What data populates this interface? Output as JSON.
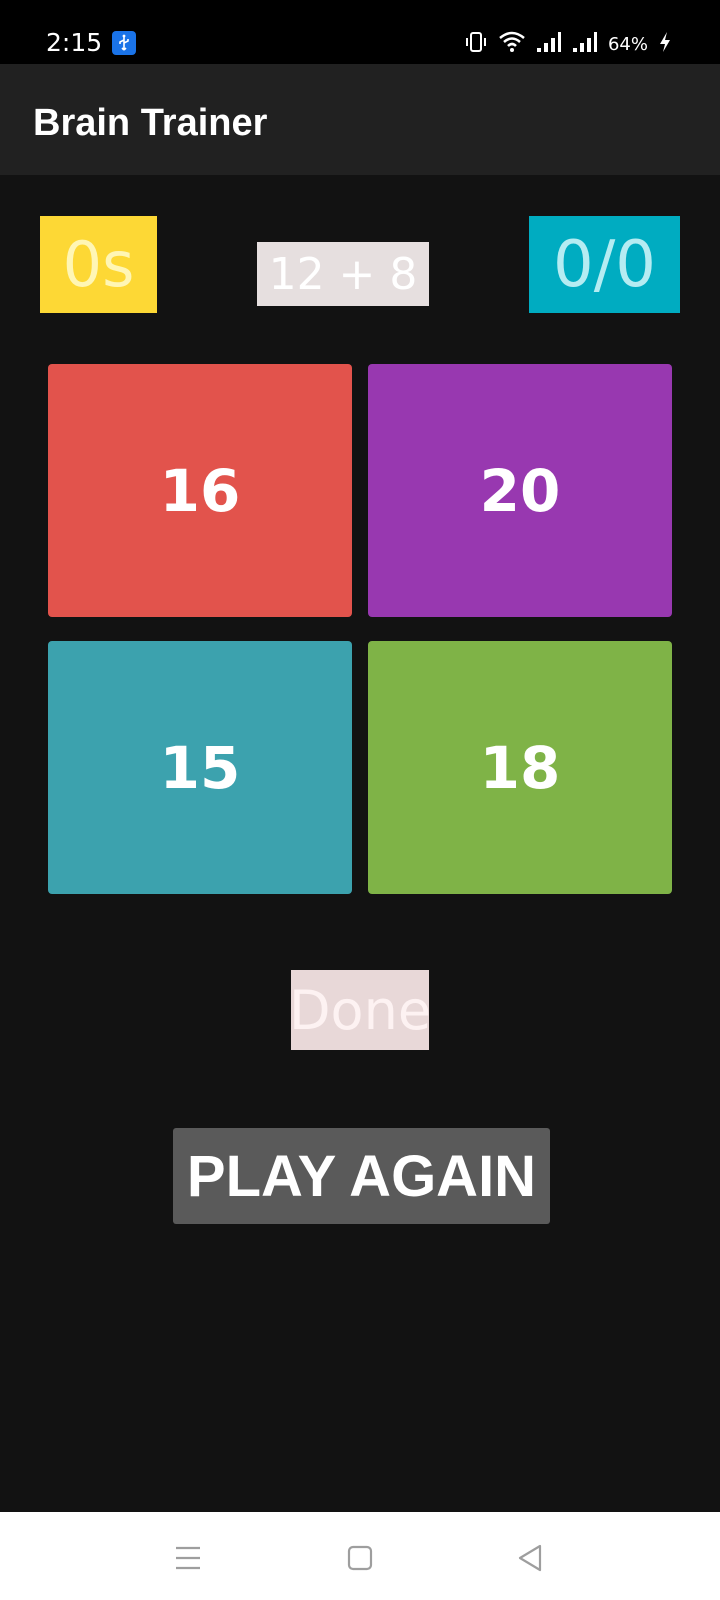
{
  "status_bar": {
    "time": "2:15",
    "battery": "64%",
    "icons": [
      "usb-icon",
      "vibrate-icon",
      "wifi-icon",
      "signal-icon",
      "signal-icon",
      "charging-icon"
    ]
  },
  "app": {
    "title": "Brain Trainer"
  },
  "game": {
    "timer": "0s",
    "question": "12 + 8",
    "score": "0/0",
    "answers": [
      "16",
      "20",
      "15",
      "18"
    ],
    "result": "Done",
    "play_again_label": "PLAY AGAIN"
  },
  "nav_bar": {
    "icons": [
      "menu-icon",
      "home-icon",
      "back-icon"
    ]
  },
  "colors": {
    "timer_bg": "#fdd835",
    "question_bg": "#e6dfdf",
    "score_bg": "#00acc1",
    "answer_bgs": [
      "#e2534c",
      "#9838b0",
      "#3ca2ae",
      "#7fb347"
    ],
    "play_again_bg": "#5a5a5a"
  }
}
